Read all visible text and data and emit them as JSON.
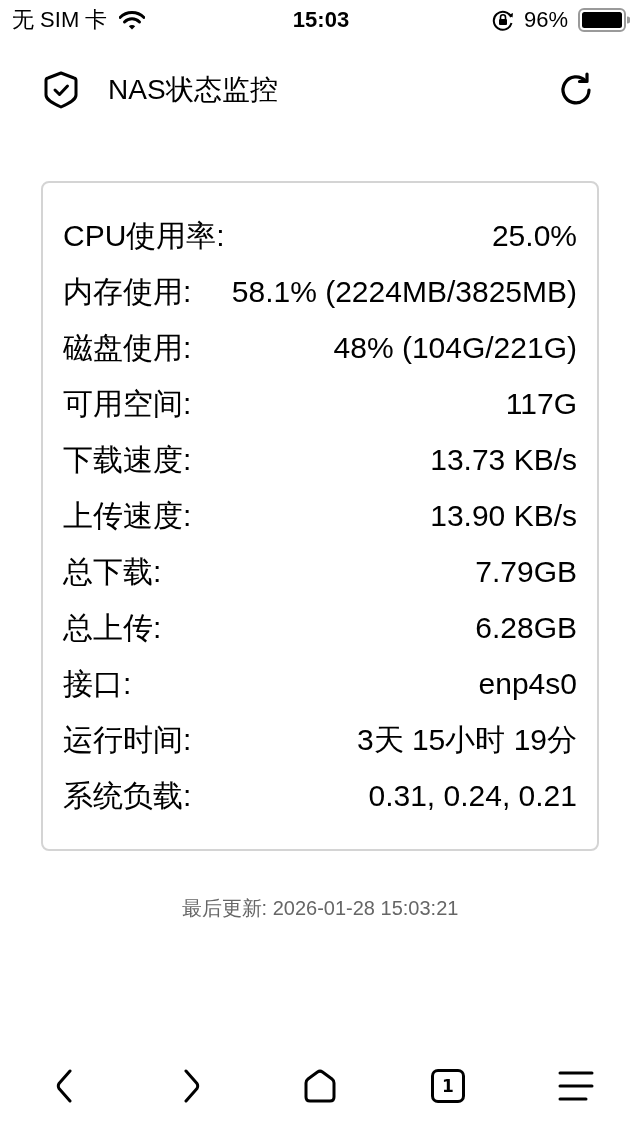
{
  "status_bar": {
    "carrier": "无 SIM 卡",
    "time": "15:03",
    "battery_percent": "96%"
  },
  "header": {
    "title": "NAS状态监控"
  },
  "stats": [
    {
      "label": "CPU使用率:",
      "value": "25.0%"
    },
    {
      "label": "内存使用:",
      "value": "58.1% (2224MB/3825MB)"
    },
    {
      "label": "磁盘使用:",
      "value": "48% (104G/221G)"
    },
    {
      "label": "可用空间:",
      "value": "117G"
    },
    {
      "label": "下载速度:",
      "value": "13.73 KB/s"
    },
    {
      "label": "上传速度:",
      "value": "13.90 KB/s"
    },
    {
      "label": "总下载:",
      "value": "7.79GB"
    },
    {
      "label": "总上传:",
      "value": "6.28GB"
    },
    {
      "label": "接口:",
      "value": "enp4s0"
    },
    {
      "label": "运行时间:",
      "value": "3天 15小时 19分"
    },
    {
      "label": "系统负载:",
      "value": "0.31, 0.24, 0.21"
    }
  ],
  "footer": {
    "last_updated": "最后更新: 2026-01-28 15:03:21"
  },
  "toolbar": [
    {
      "kind": "back"
    },
    {
      "kind": "forward"
    },
    {
      "kind": "home"
    },
    {
      "kind": "tabs",
      "count": "1"
    },
    {
      "kind": "menu"
    }
  ]
}
